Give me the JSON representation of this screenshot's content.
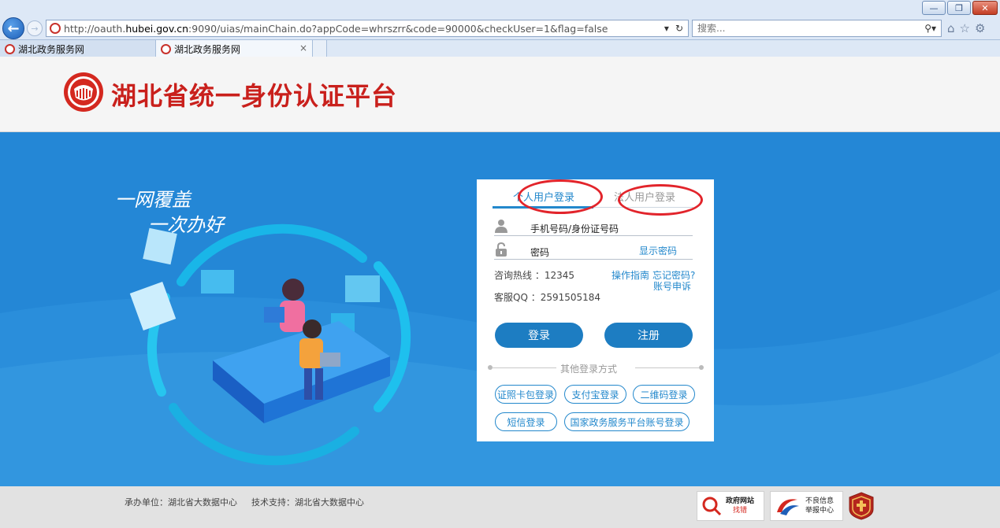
{
  "browser": {
    "url_prefix": "http://oauth.",
    "url_domain": "hubei.gov.cn",
    "url_suffix": ":9090/uias/mainChain.do?appCode=whrszrr&code=90000&checkUser=1&flag=false",
    "search_placeholder": "搜索...",
    "tabs": [
      {
        "label": "湖北政务服务网"
      },
      {
        "label": "湖北政务服务网"
      }
    ],
    "tab_close": "×"
  },
  "header": {
    "title": "湖北省统一身份认证平台"
  },
  "hero": {
    "slogan_line1": "一网覆盖",
    "slogan_line2": "一次办好"
  },
  "login": {
    "tab_personal": "个人用户登录",
    "tab_legal": "法人用户登录",
    "username_placeholder": "手机号码/身份证号码",
    "password_placeholder": "密码",
    "show_password": "显示密码",
    "hotline": "咨询热线 ：12345",
    "qq": "客服QQ ：2591505184",
    "guide": "操作指南",
    "forgot": "忘记密码?",
    "appeal": "账号申诉",
    "login_btn": "登录",
    "register_btn": "注册",
    "other_methods": "其他登录方式",
    "options": [
      "证照卡包登录",
      "支付宝登录",
      "二维码登录",
      "短信登录",
      "国家政务服务平台账号登录"
    ]
  },
  "footer": {
    "organizer": "承办单位：湖北省大数据中心",
    "support": "技术支持：湖北省大数据中心",
    "badge1_line1": "政府网站",
    "badge1_line2": "找错",
    "badge2_line1": "不良信息",
    "badge2_line2": "举报中心"
  },
  "colors": {
    "accent": "#2388cc",
    "hero_bg": "#2487d6",
    "title_red": "#c9201c",
    "highlight_ring": "#e2242b"
  }
}
